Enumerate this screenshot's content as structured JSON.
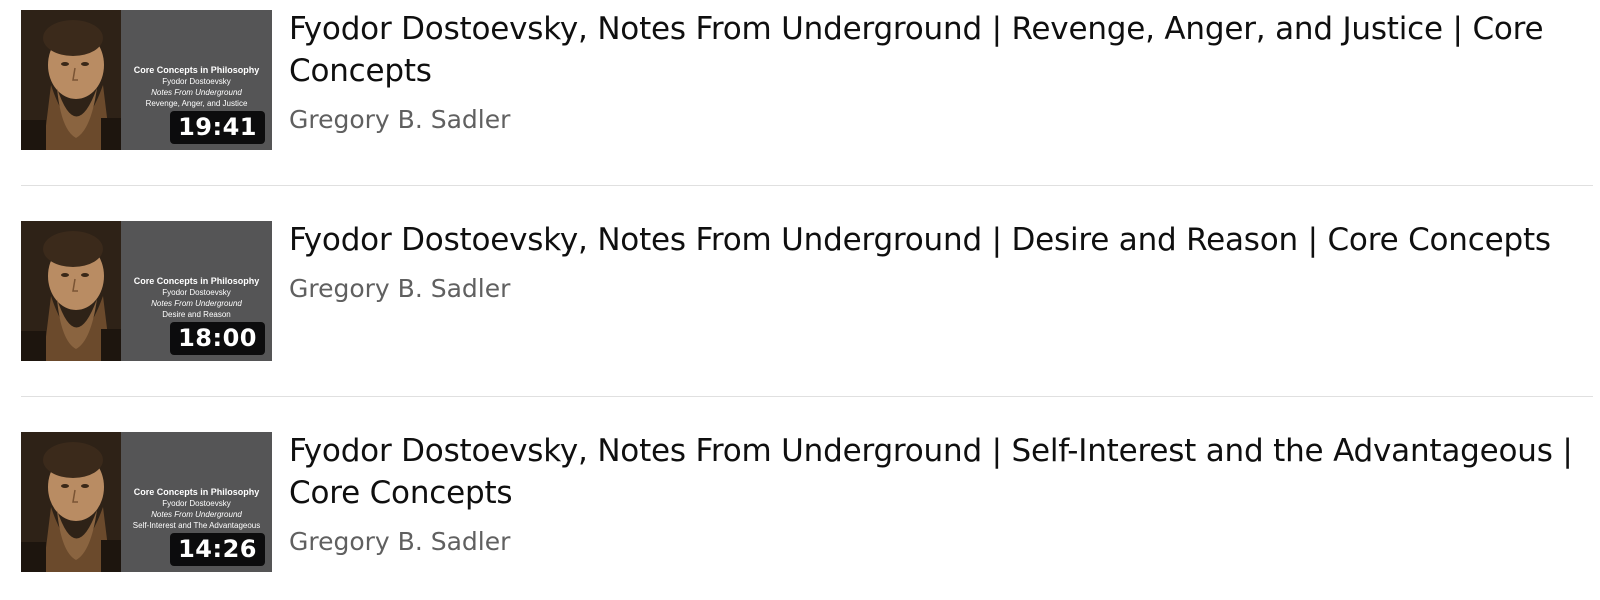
{
  "videos": [
    {
      "title": "Fyodor Dostoevsky, Notes From Underground | Revenge, Anger, and Justice | Core Concepts",
      "channel": "Gregory B. Sadler",
      "duration": "19:41",
      "thumbnail": {
        "series": "Core Concepts in Philosophy",
        "author": "Fyodor Dostoevsky",
        "work": "Notes From Underground",
        "topic": "Revenge, Anger, and Justice"
      }
    },
    {
      "title": "Fyodor Dostoevsky, Notes From Underground | Desire and Reason | Core Concepts",
      "channel": "Gregory B. Sadler",
      "duration": "18:00",
      "thumbnail": {
        "series": "Core Concepts in Philosophy",
        "author": "Fyodor Dostoevsky",
        "work": "Notes From Underground",
        "topic": "Desire and Reason"
      }
    },
    {
      "title": "Fyodor Dostoevsky, Notes From Underground | Self-Interest and the Advantageous | Core Concepts",
      "channel": "Gregory B. Sadler",
      "duration": "14:26",
      "thumbnail": {
        "series": "Core Concepts in Philosophy",
        "author": "Fyodor Dostoevsky",
        "work": "Notes From Underground",
        "topic": "Self-Interest and The Advantageous"
      }
    }
  ],
  "colors": {
    "title": "#0f0f0f",
    "channel": "#606060",
    "divider": "#e0e0e0",
    "thumbnail_bg": "#555556"
  }
}
